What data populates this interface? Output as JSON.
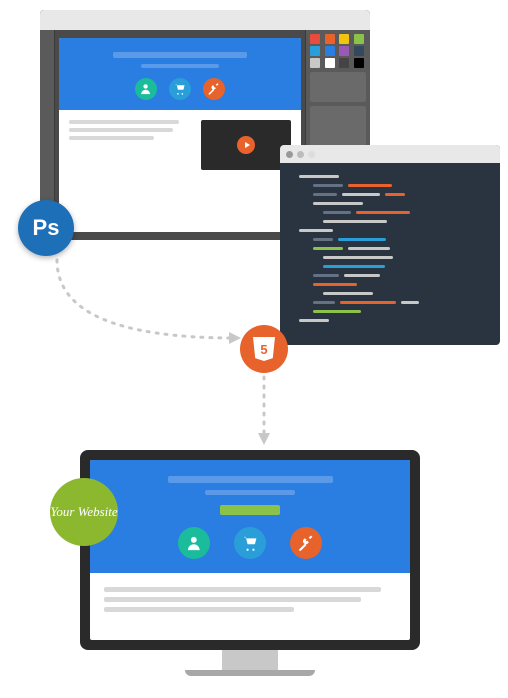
{
  "badges": {
    "photoshop": "Ps",
    "html5": "5",
    "your_website": "Your Website"
  },
  "design_mockup": {
    "icons": [
      "person-icon",
      "cart-icon",
      "tools-icon"
    ]
  },
  "code_editor": {
    "lines": [
      [
        {
          "indent": 0,
          "w": 40,
          "c": "#c8c8c8"
        }
      ],
      [
        {
          "indent": 14,
          "w": 30,
          "c": "#657184"
        },
        {
          "w": 44,
          "c": "#e8632c"
        }
      ],
      [
        {
          "indent": 14,
          "w": 24,
          "c": "#657184"
        },
        {
          "w": 38,
          "c": "#c8c8c8"
        },
        {
          "w": 20,
          "c": "#e8632c"
        }
      ],
      [
        {
          "indent": 14,
          "w": 50,
          "c": "#c8c8c8"
        }
      ],
      [
        {
          "indent": 24,
          "w": 28,
          "c": "#657184"
        },
        {
          "w": 54,
          "c": "#e8632c"
        }
      ],
      [
        {
          "indent": 24,
          "w": 64,
          "c": "#c8c8c8"
        }
      ],
      [
        {
          "indent": 0,
          "w": 34,
          "c": "#c8c8c8"
        }
      ],
      [
        {
          "indent": 14,
          "w": 20,
          "c": "#657184"
        },
        {
          "w": 48,
          "c": "#2a9ed8"
        }
      ],
      [
        {
          "indent": 14,
          "w": 30,
          "c": "#8bc34a"
        },
        {
          "w": 42,
          "c": "#c8c8c8"
        }
      ],
      [
        {
          "indent": 24,
          "w": 70,
          "c": "#c8c8c8"
        }
      ],
      [
        {
          "indent": 24,
          "w": 62,
          "c": "#2a9ed8"
        }
      ],
      [
        {
          "indent": 14,
          "w": 26,
          "c": "#657184"
        },
        {
          "w": 36,
          "c": "#c8c8c8"
        }
      ],
      [
        {
          "indent": 14,
          "w": 44,
          "c": "#e8632c"
        }
      ],
      [
        {
          "indent": 24,
          "w": 50,
          "c": "#c8c8c8"
        }
      ],
      [
        {
          "indent": 14,
          "w": 22,
          "c": "#657184"
        },
        {
          "w": 56,
          "c": "#e8632c"
        },
        {
          "w": 18,
          "c": "#c8c8c8"
        }
      ],
      [
        {
          "indent": 14,
          "w": 48,
          "c": "#8bc34a"
        }
      ],
      [
        {
          "indent": 0,
          "w": 30,
          "c": "#c8c8c8"
        }
      ]
    ]
  },
  "swatch_colors": [
    "#e74c3c",
    "#e8632c",
    "#f1c40f",
    "#8bc34a",
    "#2a9ed8",
    "#2a7de1",
    "#9b59b6",
    "#34495e",
    "#c8c8c8",
    "#ffffff",
    "#444444",
    "#000000"
  ],
  "monitor": {
    "icons": [
      "person-icon",
      "cart-icon",
      "tools-icon"
    ]
  },
  "colors": {
    "icon_teal": "#1abc9c",
    "icon_blue": "#2a9ed8",
    "icon_orange": "#e8632c"
  }
}
